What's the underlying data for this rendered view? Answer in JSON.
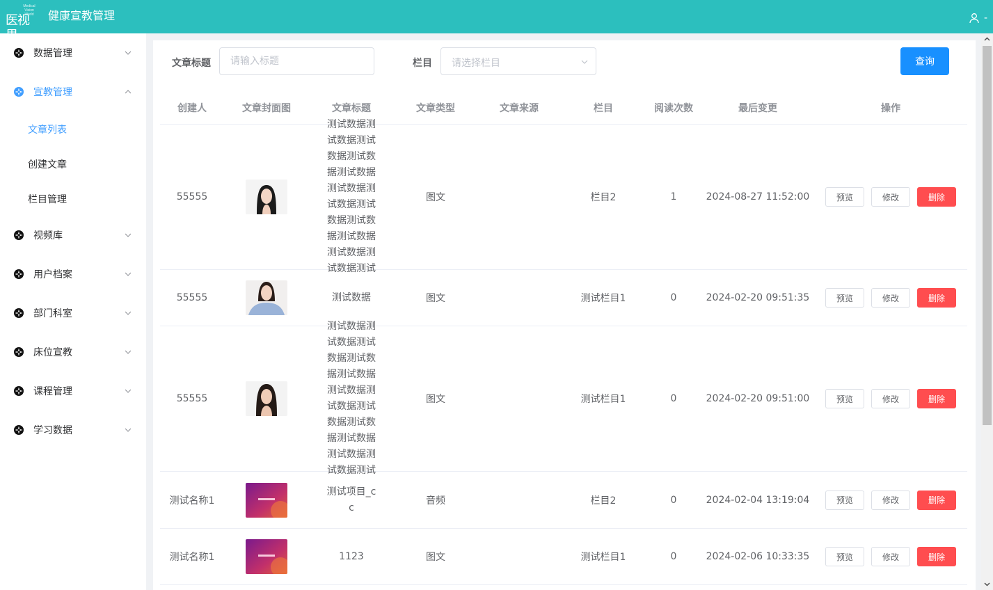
{
  "header": {
    "logo_small": "Medical Vision World",
    "logo_big": "医视界",
    "title": "健康宣教管理",
    "user_name": "-"
  },
  "sidebar": {
    "items": [
      {
        "label": "数据管理",
        "icon": "menu-icon",
        "expanded": false
      },
      {
        "label": "宣教管理",
        "icon": "menu-icon",
        "expanded": true,
        "active": true
      },
      {
        "label": "视频库",
        "icon": "menu-icon",
        "expanded": false
      },
      {
        "label": "用户档案",
        "icon": "menu-icon",
        "expanded": false
      },
      {
        "label": "部门科室",
        "icon": "menu-icon",
        "expanded": false
      },
      {
        "label": "床位宣教",
        "icon": "menu-icon",
        "expanded": false
      },
      {
        "label": "课程管理",
        "icon": "menu-icon",
        "expanded": false
      },
      {
        "label": "学习数据",
        "icon": "menu-icon",
        "expanded": false
      }
    ],
    "sub_items": [
      {
        "label": "文章列表",
        "active": true
      },
      {
        "label": "创建文章",
        "active": false
      },
      {
        "label": "栏目管理",
        "active": false
      }
    ]
  },
  "filters": {
    "title_label": "文章标题",
    "title_placeholder": "请输入标题",
    "title_value": "",
    "column_label": "栏目",
    "column_placeholder": "请选择栏目",
    "search_button": "查询"
  },
  "table": {
    "headers": [
      "创建人",
      "文章封面图",
      "文章标题",
      "文章类型",
      "文章来源",
      "栏目",
      "阅读次数",
      "最后变更",
      "操作"
    ],
    "rows": [
      {
        "creator": "55555",
        "cover": "portrait-1",
        "title": "测试数据测试数据测试数据测试数据测试数据测试数据测试数据测试数据测试数据测试数据测试数据测试数据测试",
        "type": "图文",
        "source": "",
        "column": "栏目2",
        "reads": "1",
        "updated": "2024-08-27 11:52:00"
      },
      {
        "creator": "55555",
        "cover": "portrait-2",
        "title": "测试数据",
        "type": "图文",
        "source": "",
        "column": "测试栏目1",
        "reads": "0",
        "updated": "2024-02-20 09:51:35"
      },
      {
        "creator": "55555",
        "cover": "portrait-3",
        "title": "测试数据测试数据测试数据测试数据测试数据测试数据测试数据测试数据测试数据测试数据测试数据测试数据测试",
        "type": "图文",
        "source": "",
        "column": "测试栏目1",
        "reads": "0",
        "updated": "2024-02-20 09:51:00"
      },
      {
        "creator": "测试名称1",
        "cover": "banner",
        "title": "测试项目_cc",
        "type": "音频",
        "source": "",
        "column": "栏目2",
        "reads": "0",
        "updated": "2024-02-04 13:19:04"
      },
      {
        "creator": "测试名称1",
        "cover": "banner",
        "title": "1123",
        "type": "图文",
        "source": "",
        "column": "测试栏目1",
        "reads": "0",
        "updated": "2024-02-06 10:33:35"
      }
    ],
    "actions": {
      "preview": "预览",
      "edit": "修改",
      "delete": "删除"
    }
  },
  "colors": {
    "header": "#2cbfbe",
    "accent": "#409eff",
    "primary_button": "#1890ff",
    "danger": "#ff4d4f"
  }
}
